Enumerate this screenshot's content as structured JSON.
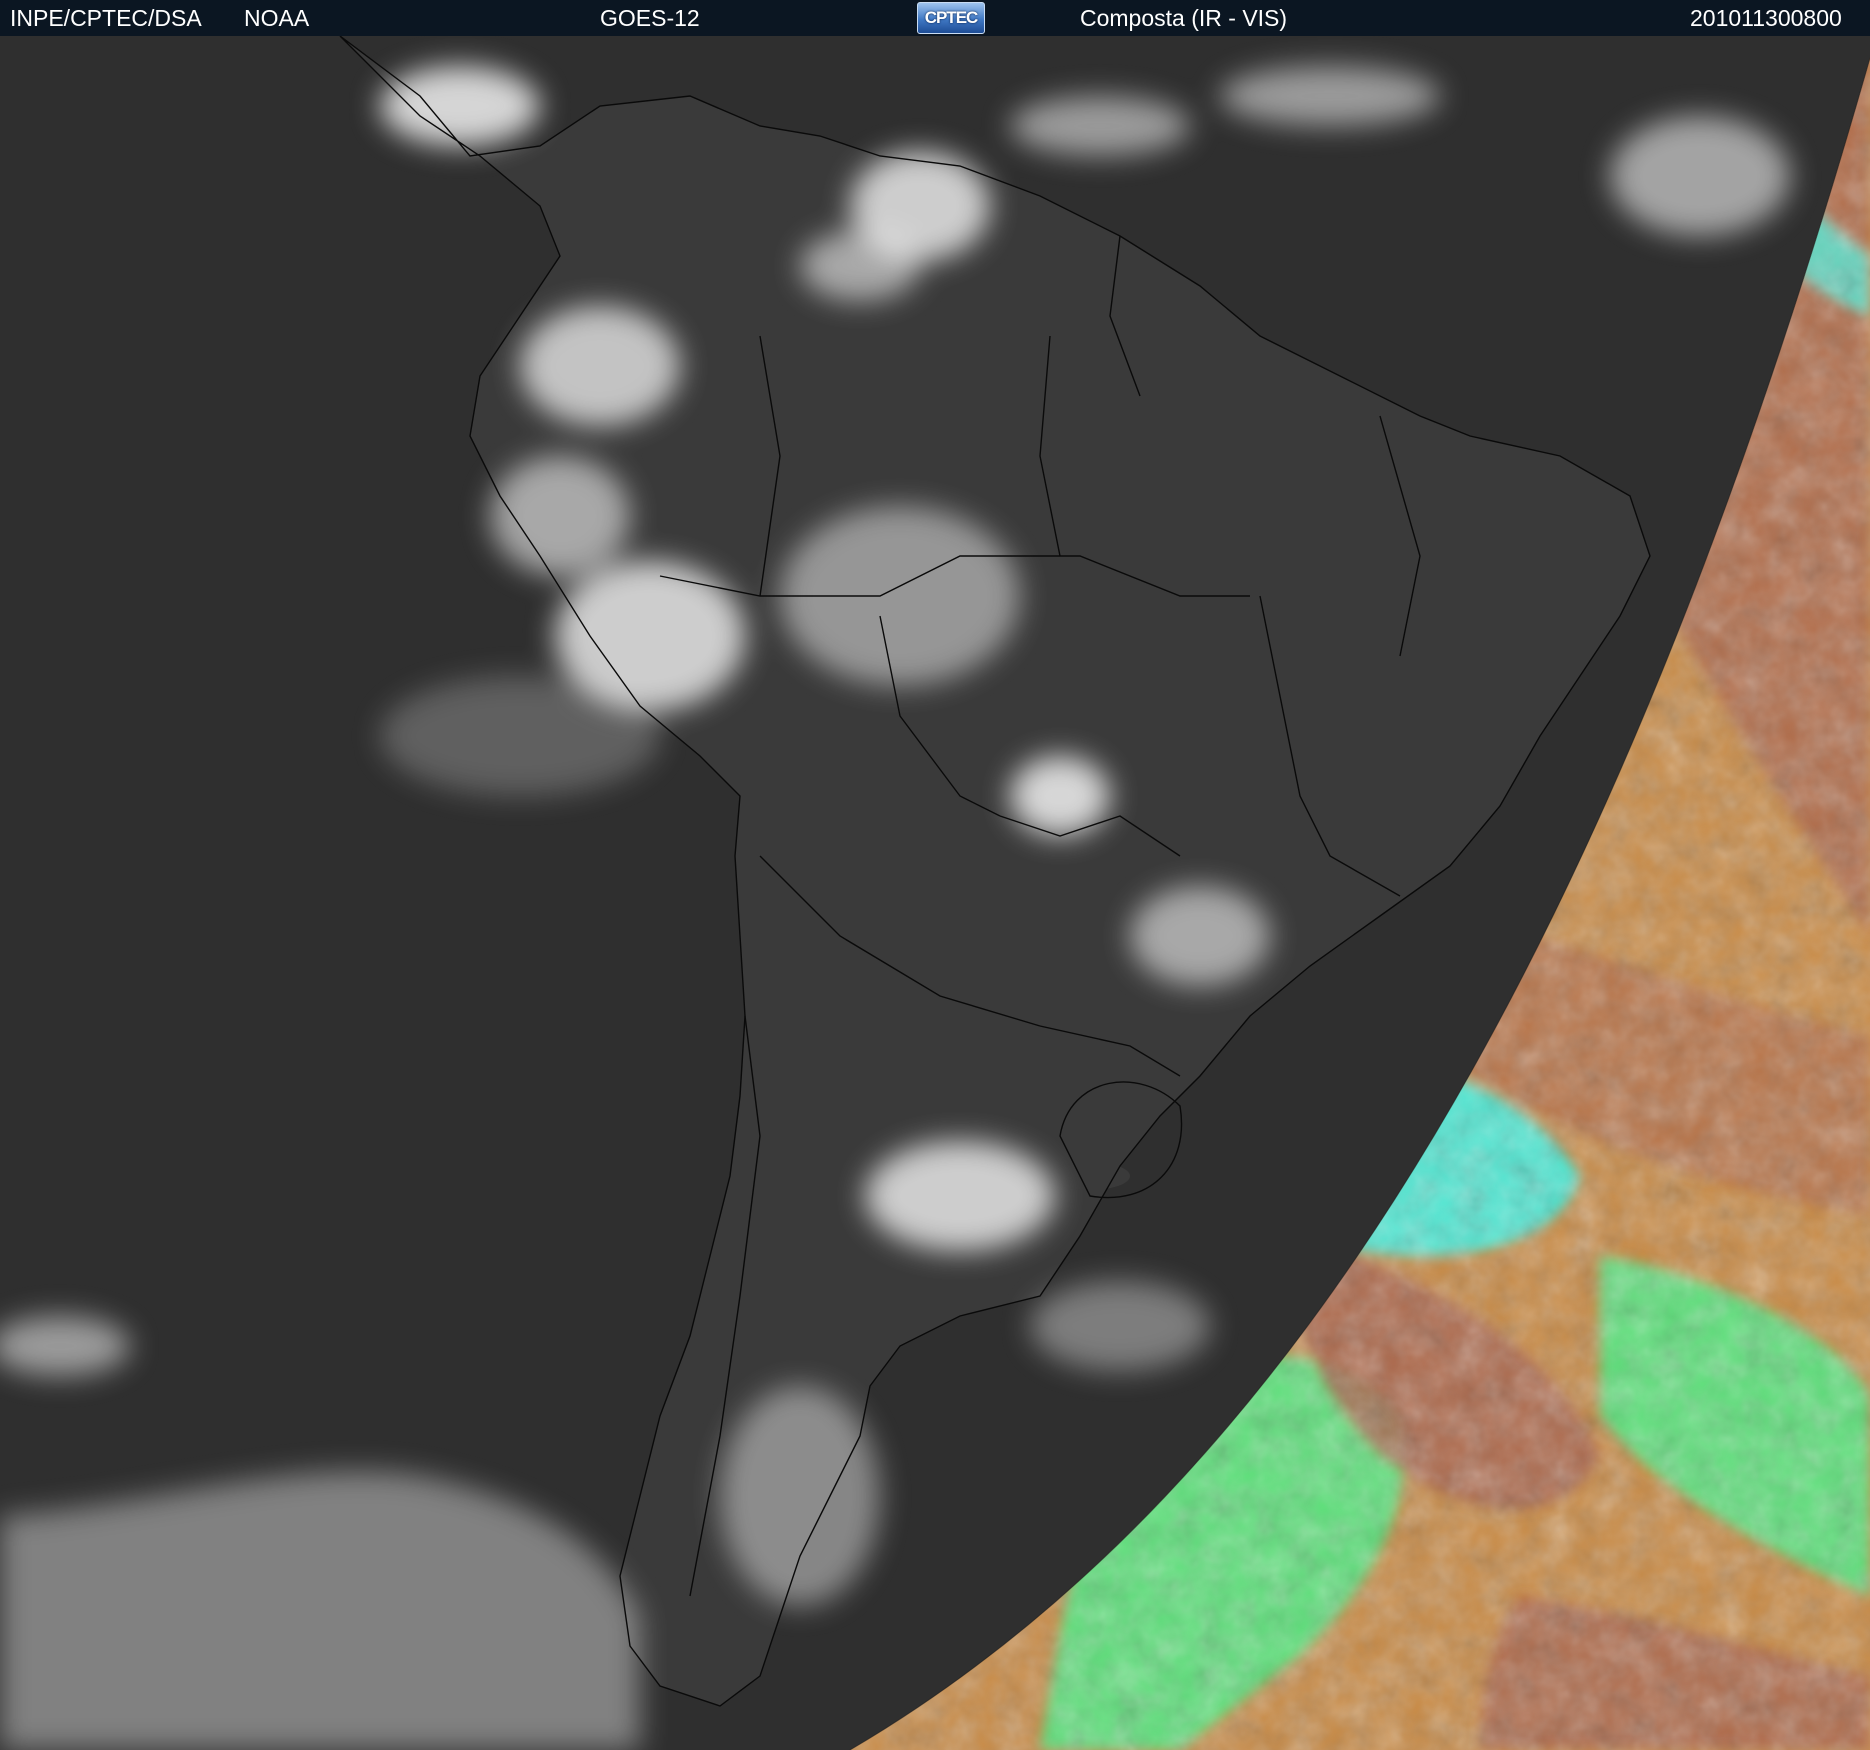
{
  "header": {
    "institution": "INPE/CPTEC/DSA",
    "agency": "NOAA",
    "satellite": "GOES-12",
    "logo_text": "CPTEC",
    "product": "Composta (IR - VIS)",
    "timestamp": "201011300800"
  },
  "map": {
    "ir_gray": "#2f2f2f",
    "land_gray": "#3a3a3a",
    "cloud_white": "#f2f2f2",
    "border_color": "#0a0a0a",
    "vis_green": "#5de07a",
    "vis_cyan": "#4fe7d2",
    "vis_brown": "#a9634d",
    "vis_orange": "#c98b46"
  }
}
